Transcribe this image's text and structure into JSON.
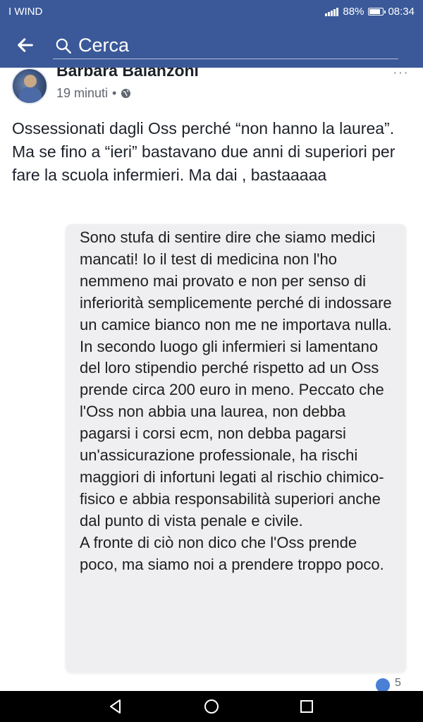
{
  "status_bar": {
    "carrier": "I WIND",
    "battery": "88%",
    "battery_level": 0.88,
    "time": "08:34"
  },
  "app_bar": {
    "search_placeholder": "Cerca"
  },
  "post": {
    "author": "Barbara Balanzoni",
    "timestamp": "19 minuti",
    "separator": "•",
    "text": "Ossessionati dagli Oss perché “non hanno la laurea”. Ma se fino a “ieri” bastavano due anni di superiori per fare la scuola infermieri. Ma dai , bastaaaaa",
    "quoted_text": "Sono stufa di sentire dire che siamo medici mancati! Io il test di medicina non l'ho nemmeno mai provato e non per senso di inferiorità semplicemente perché di indossare un camice bianco non me ne importava nulla.\nIn secondo luogo gli infermieri si lamentano del loro stipendio perché rispetto ad un Oss prende circa 200 euro in meno. Peccato che l'Oss non abbia una laurea, non debba pagarsi i corsi ecm, non debba pagarsi un'assicurazione professionale, ha rischi maggiori di infortuni legati al rischio chimico-fisico e abbia responsabilità superiori anche dal punto di vista penale e civile.\nA fronte di ciò non dico che l'Oss prende poco, ma siamo noi a prendere troppo poco.",
    "reaction_count": "5"
  },
  "icons": {
    "back": "arrow-left-icon",
    "search": "search-icon",
    "audience": "globe-icon",
    "nav_back": "triangle-back-icon",
    "nav_home": "circle-home-icon",
    "nav_recent": "square-recent-icon"
  }
}
